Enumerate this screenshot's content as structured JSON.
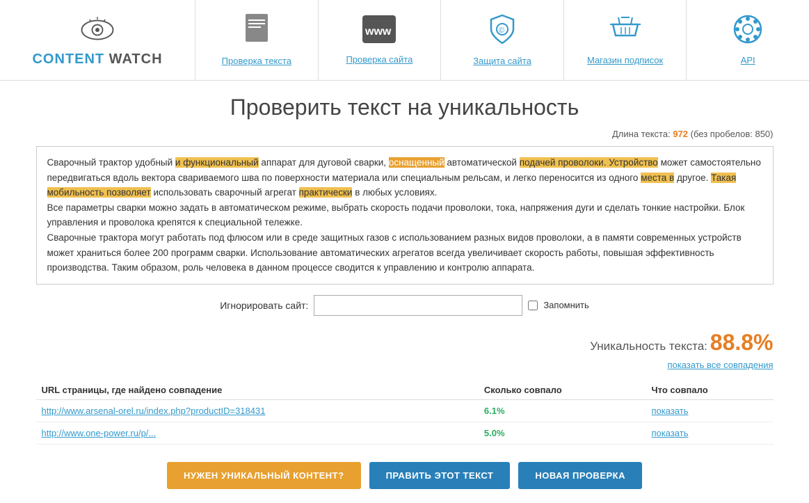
{
  "logo": {
    "text_content": "CONTENT WATCH",
    "text_cyan": "CONTENT",
    "text_gray": " WATCH"
  },
  "nav": {
    "items": [
      {
        "id": "check-text",
        "label": "Проверка текста",
        "icon": "text-icon"
      },
      {
        "id": "check-site",
        "label": "Проверка сайта",
        "icon": "www-icon"
      },
      {
        "id": "protect-site",
        "label": "Защита сайта",
        "icon": "shield-icon"
      },
      {
        "id": "shop",
        "label": "Магазин подписок",
        "icon": "basket-icon"
      },
      {
        "id": "api",
        "label": "API",
        "icon": "api-icon"
      }
    ]
  },
  "page": {
    "title": "Проверить текст на уникальность",
    "text_length_label": "Длина текста:",
    "text_length_value": "972",
    "text_length_no_spaces": "(без пробелов: 850)"
  },
  "text_content": {
    "paragraph1": "Сварочный трактор удобный и функциональный аппарат для дуговой сварки, оснащенный автоматической подачей проволоки. Устройство может самостоятельно передвигаться вдоль вектора свариваемого шва по поверхности материала или специальным рельсам, и легко переносится из одного места в другое. Такая мобильность позволяет использовать сварочный агрегат практически в любых условиях.",
    "paragraph2": "Все параметры сварки можно задать в автоматическом режиме, выбрать скорость подачи проволоки, тока, напряжения дуги и сделать тонкие настройки. Блок управления и проволока крепятся к специальной тележке.",
    "paragraph3": "Сварочные трактора могут работать под флюсом или в среде защитных газов с использованием разных видов проволоки, а в памяти современных устройств может храниться более 200 программ сварки. Использование автоматических агрегатов всегда увеличивает скорость работы, повышая эффективность производства. Таким образом, роль человека в данном процессе сводится к управлению и контролю аппарата."
  },
  "ignore_site": {
    "label": "Игнорировать сайт:",
    "placeholder": "",
    "remember_label": "Запомнить"
  },
  "score": {
    "label": "Уникальность текста:",
    "value": "88.8%",
    "show_all_link": "показать все совпадения"
  },
  "table": {
    "headers": [
      "URL страницы, где найдено совпадение",
      "Сколько совпало",
      "Что совпало"
    ],
    "rows": [
      {
        "url": "http://www.arsenal-orel.ru/index.php?productID=318431",
        "percent": "6.1%",
        "action": "показать"
      },
      {
        "url": "http://www.one-power.ru/p/...",
        "percent": "5.0%",
        "action": "показать"
      }
    ]
  },
  "buttons": {
    "need_unique": "НУЖЕН УНИКАЛЬНЫЙ КОНТЕНТ?",
    "edit_text": "ПРАВИТЬ ЭТОТ ТЕКСТ",
    "new_check": "НОВАЯ ПРОВЕРКА"
  }
}
